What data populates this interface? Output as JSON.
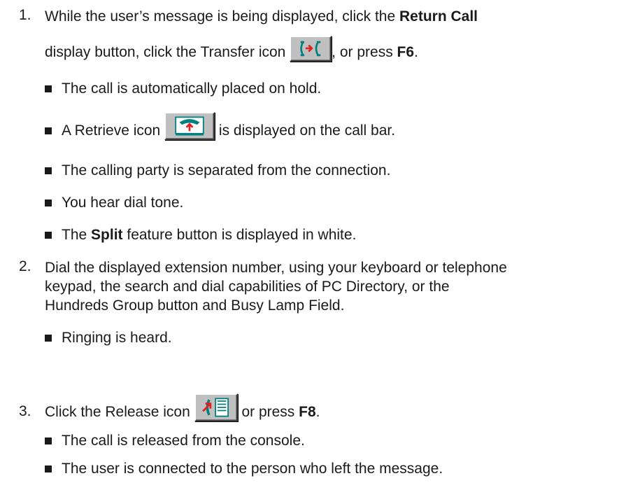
{
  "steps": [
    {
      "number": "1.",
      "line1_pre": "While the user’s message is being displayed, click the ",
      "line1_bold": "Return Call",
      "line2_pre": "display button, click the Transfer icon ",
      "line2_post": ", or press ",
      "line2_bold": "F6",
      "line2_end": ".",
      "icon": "transfer-icon",
      "bullets": [
        {
          "text": "The call is automatically placed on hold."
        },
        {
          "pre": "A Retrieve icon ",
          "post": " is displayed on the call bar.",
          "icon": "retrieve-icon"
        },
        {
          "text": "The calling party is separated from the connection."
        },
        {
          "text": "You hear dial tone."
        },
        {
          "pre": "The ",
          "bold": "Split",
          "post": " feature button is displayed in white."
        }
      ]
    },
    {
      "number": "2.",
      "lines": [
        "Dial the displayed extension number, using your keyboard or telephone",
        "keypad, the search and dial capabilities of PC Directory, or the",
        "Hundreds Group button and Busy Lamp Field."
      ],
      "bullets": [
        {
          "text": "Ringing is heard."
        }
      ]
    },
    {
      "number": "3.",
      "pre": "Click the Release icon ",
      "post": " or press ",
      "bold": "F8",
      "end": ".",
      "icon": "release-icon",
      "bullets": [
        {
          "text": "The call is released from the console."
        },
        {
          "text": "The user is connected to the person who left the message."
        }
      ]
    }
  ],
  "colors": {
    "text": "#1a1a1a",
    "icon_face": "#c0c0c0",
    "accent_red": "#e02020",
    "accent_teal": "#008080"
  }
}
